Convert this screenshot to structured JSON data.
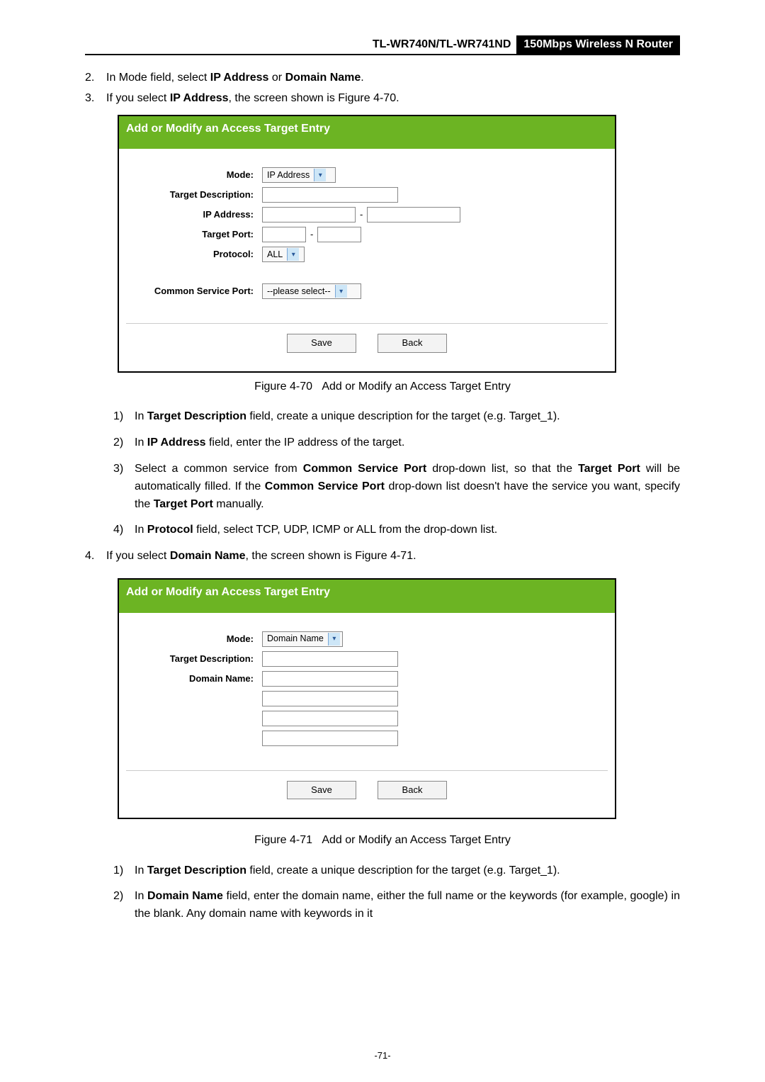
{
  "header": {
    "model": "TL-WR740N/TL-WR741ND",
    "router": "150Mbps Wireless N Router"
  },
  "item2": {
    "num": "2.",
    "pre": "In Mode field, select ",
    "b1": "IP Address",
    "mid": " or ",
    "b2": "Domain Name",
    "post": "."
  },
  "item3": {
    "num": "3.",
    "pre": "If you select ",
    "b1": "IP Address",
    "post": ", the screen shown is Figure 4-70."
  },
  "fig70": {
    "title": "Add or Modify an Access Target Entry",
    "labels": {
      "mode": "Mode:",
      "target_desc": "Target Description:",
      "ip": "IP Address:",
      "target_port": "Target Port:",
      "protocol": "Protocol:",
      "common": "Common Service Port:"
    },
    "mode_value": "IP Address",
    "protocol_value": "ALL",
    "common_value": "--please select--",
    "save": "Save",
    "back": "Back",
    "caption_pre": "Figure 4-70 ",
    "caption": "Add or Modify an Access Target Entry"
  },
  "sub3": {
    "s1": {
      "num": "1)",
      "pre": "In ",
      "b1": "Target Description",
      "post": " field, create a unique description for the target (e.g. Target_1)."
    },
    "s2": {
      "num": "2)",
      "pre": "In ",
      "b1": "IP Address",
      "post": " field, enter the IP address of the target."
    },
    "s3": {
      "num": "3)",
      "pre": "Select a common service from ",
      "b1": "Common Service Port",
      "mid": " drop-down list, so that the ",
      "b2": "Target Port",
      "mid2": " will be automatically filled. If the ",
      "b3": "Common Service Port",
      "mid3": " drop-down list doesn't have the service you want, specify the ",
      "b4": "Target Port",
      "post": " manually."
    },
    "s4": {
      "num": "4)",
      "pre": "In ",
      "b1": "Protocol",
      "post": " field, select TCP, UDP, ICMP or ALL from the drop-down list."
    }
  },
  "item4": {
    "num": "4.",
    "pre": "If you select ",
    "b1": "Domain Name",
    "post": ", the screen shown is Figure 4-71."
  },
  "fig71": {
    "title": "Add or Modify an Access Target Entry",
    "labels": {
      "mode": "Mode:",
      "target_desc": "Target Description:",
      "domain": "Domain Name:"
    },
    "mode_value": "Domain Name",
    "save": "Save",
    "back": "Back",
    "caption_pre": "Figure 4-71 ",
    "caption": "Add or Modify an Access Target Entry"
  },
  "sub4": {
    "s1": {
      "num": "1)",
      "pre": "In ",
      "b1": "Target Description",
      "post": " field, create a unique description for the target (e.g. Target_1)."
    },
    "s2": {
      "num": "2)",
      "pre": "In ",
      "b1": "Domain Name",
      "post": " field, enter the domain name, either the full name or the keywords (for example, google) in the blank. Any domain name with keywords in it"
    }
  },
  "dash": "-",
  "page_num": "-71-"
}
